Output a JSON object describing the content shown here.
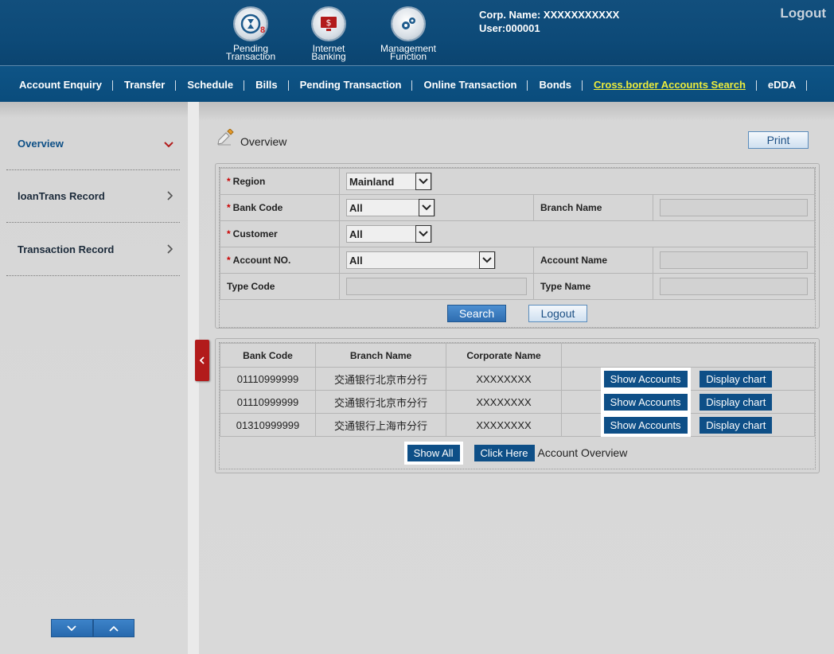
{
  "header": {
    "icons": [
      {
        "name": "pending-transaction",
        "label_line1": "Pending",
        "label_line2": "Transaction",
        "badge": "8"
      },
      {
        "name": "internet-banking",
        "label_line1": "Internet",
        "label_line2": "Banking"
      },
      {
        "name": "management-function",
        "label_line1": "Management",
        "label_line2": "Function"
      }
    ],
    "corp_name": "Corp. Name: XXXXXXXXXXX",
    "user": "User:000001",
    "logout": "Logout"
  },
  "nav": [
    "Account Enquiry",
    "Transfer",
    "Schedule",
    "Bills",
    "Pending Transaction",
    "Online Transaction",
    "Bonds",
    "Cross.border Accounts Search",
    "eDDA"
  ],
  "nav_active_index": 7,
  "sidebar": {
    "items": [
      "Overview",
      "loanTrans Record",
      "Transaction Record"
    ]
  },
  "main": {
    "title": "Overview",
    "print": "Print",
    "form": {
      "region_label": "Region",
      "region_value": "Mainland",
      "bank_code_label": "Bank Code",
      "bank_code_value": "All",
      "branch_name_label": "Branch Name",
      "customer_label": "Customer",
      "customer_value": "All",
      "account_no_label": "Account NO.",
      "account_no_value": "All",
      "account_name_label": "Account Name",
      "type_code_label": "Type Code",
      "type_name_label": "Type Name",
      "search": "Search",
      "logout": "Logout"
    },
    "results": {
      "headers": [
        "Bank Code",
        "Branch Name",
        "Corporate Name",
        ""
      ],
      "rows": [
        {
          "bank_code": "01110999999",
          "branch": "交通银行北京市分行",
          "corp": "XXXXXXXX"
        },
        {
          "bank_code": "01110999999",
          "branch": "交通银行北京市分行",
          "corp": "XXXXXXXX"
        },
        {
          "bank_code": "01310999999",
          "branch": "交通银行上海市分行",
          "corp": "XXXXXXXX"
        }
      ],
      "show_accounts": "Show Accounts",
      "display_chart": "Display chart",
      "show_all": "Show All",
      "click_here": "Click Here",
      "account_overview": "Account Overview"
    }
  }
}
